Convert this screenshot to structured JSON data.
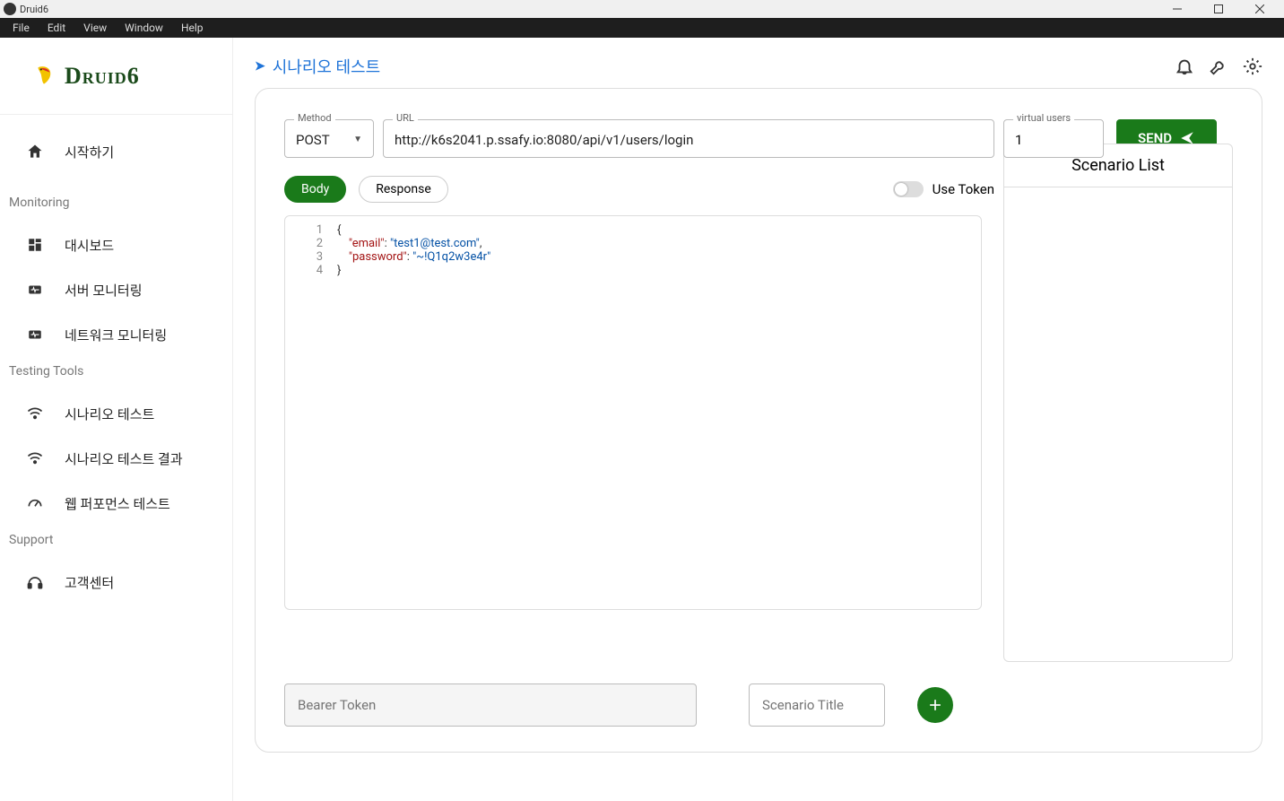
{
  "window": {
    "title": "Druid6"
  },
  "menubar": [
    "File",
    "Edit",
    "View",
    "Window",
    "Help"
  ],
  "logo": {
    "text": "Druid6"
  },
  "sidebar": {
    "start": "시작하기",
    "sections": [
      {
        "head": "Monitoring",
        "items": [
          "대시보드",
          "서버 모니터링",
          "네트워크 모니터링"
        ]
      },
      {
        "head": "Testing Tools",
        "items": [
          "시나리오 테스트",
          "시나리오 테스트 결과",
          "웹 퍼포먼스 테스트"
        ]
      },
      {
        "head": "Support",
        "items": [
          "고객센터"
        ]
      }
    ]
  },
  "header": {
    "title": "시나리오 테스트"
  },
  "request": {
    "method_label": "Method",
    "method": "POST",
    "url_label": "URL",
    "url": "http://k6s2041.p.ssafy.io:8080/api/v1/users/login",
    "vu_label": "virtual users",
    "vu": "1",
    "send": "SEND"
  },
  "tabs": {
    "body": "Body",
    "response": "Response",
    "use_token": "Use Token"
  },
  "editor": {
    "lines": [
      "{",
      "    \"email\": \"test1@test.com\",",
      "    \"password\": \"~!Q1q2w3e4r\"",
      "}"
    ],
    "body_json": {
      "email": "test1@test.com",
      "password": "~!Q1q2w3e4r"
    }
  },
  "scenario_list": {
    "title": "Scenario List"
  },
  "bottom": {
    "bearer_placeholder": "Bearer Token",
    "scenario_title_placeholder": "Scenario Title"
  }
}
